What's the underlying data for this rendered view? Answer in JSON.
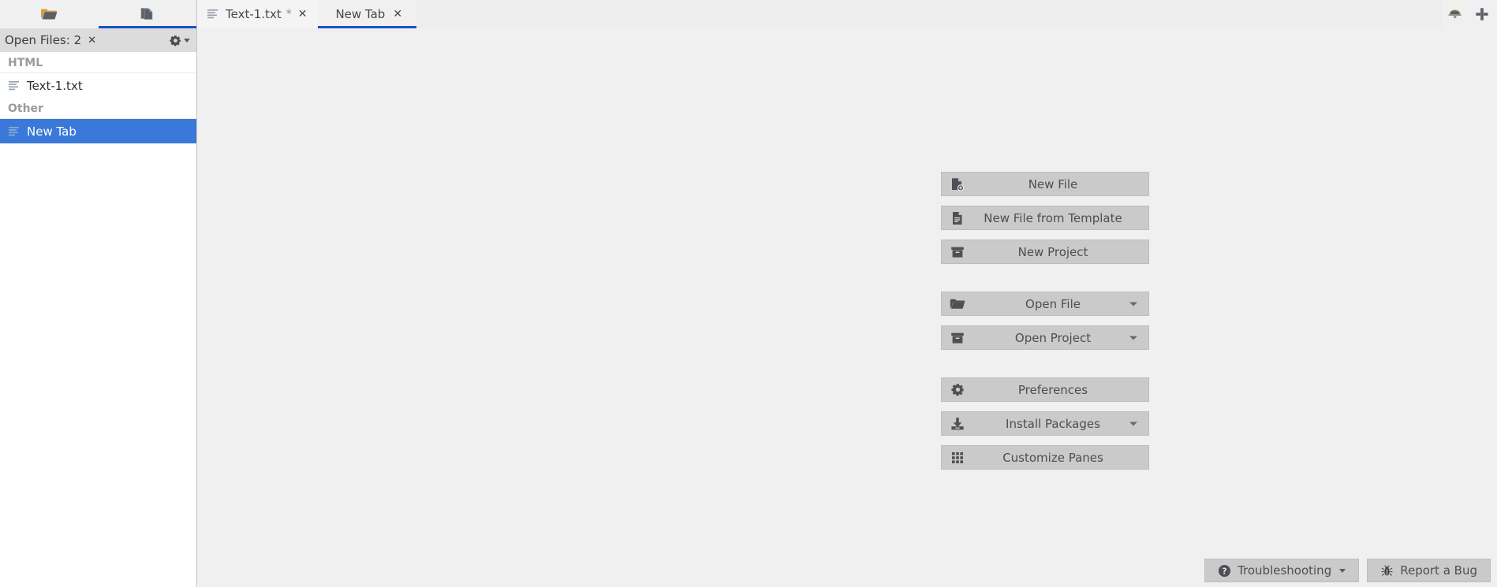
{
  "window": {
    "background": "#f0f0f0",
    "accent": "#1a53c8",
    "selection": "#3a79d9"
  },
  "sidebar_tabs": [
    {
      "name": "project-explorer",
      "icon": "folder-open-icon",
      "active": false
    },
    {
      "name": "open-files",
      "icon": "files-icon",
      "active": true
    }
  ],
  "editor_tabs": [
    {
      "label": "Text-1.txt",
      "modified_marker": "*",
      "icon": "text-lines-icon",
      "close": "✕",
      "active": false
    },
    {
      "label": "New Tab",
      "modified_marker": "",
      "icon": "",
      "close": "✕",
      "active": true
    }
  ],
  "topbar_right": [
    {
      "name": "pane-chooser-icon",
      "label": ""
    },
    {
      "name": "new-tab-plus-icon",
      "label": "+"
    }
  ],
  "sidebar": {
    "header": {
      "title": "Open Files: 2",
      "close_label": "✕",
      "gear_icon": "gear-icon"
    },
    "groups": [
      {
        "label": "HTML",
        "items": [
          {
            "label": "Text-1.txt",
            "icon": "text-lines-icon",
            "selected": false
          }
        ]
      },
      {
        "label": "Other",
        "items": [
          {
            "label": "New Tab",
            "icon": "text-lines-icon",
            "selected": true
          }
        ]
      }
    ]
  },
  "main": {
    "button_groups": [
      {
        "buttons": [
          {
            "label": "New File",
            "icon": "new-file-icon",
            "has_dropdown": false
          },
          {
            "label": "New File from Template",
            "icon": "file-template-icon",
            "has_dropdown": false
          },
          {
            "label": "New Project",
            "icon": "project-box-icon",
            "has_dropdown": false
          }
        ]
      },
      {
        "buttons": [
          {
            "label": "Open File",
            "icon": "folder-open-icon",
            "has_dropdown": true
          },
          {
            "label": "Open Project",
            "icon": "project-box-icon",
            "has_dropdown": true
          }
        ]
      },
      {
        "buttons": [
          {
            "label": "Preferences",
            "icon": "gear-icon",
            "has_dropdown": false
          },
          {
            "label": "Install Packages",
            "icon": "download-icon",
            "has_dropdown": true
          },
          {
            "label": "Customize Panes",
            "icon": "grid-icon",
            "has_dropdown": false
          }
        ]
      }
    ],
    "bottom_buttons": [
      {
        "label": "Troubleshooting",
        "icon": "question-circle-icon",
        "has_dropdown": true
      },
      {
        "label": "Report a Bug",
        "icon": "bug-icon",
        "has_dropdown": false
      }
    ]
  }
}
